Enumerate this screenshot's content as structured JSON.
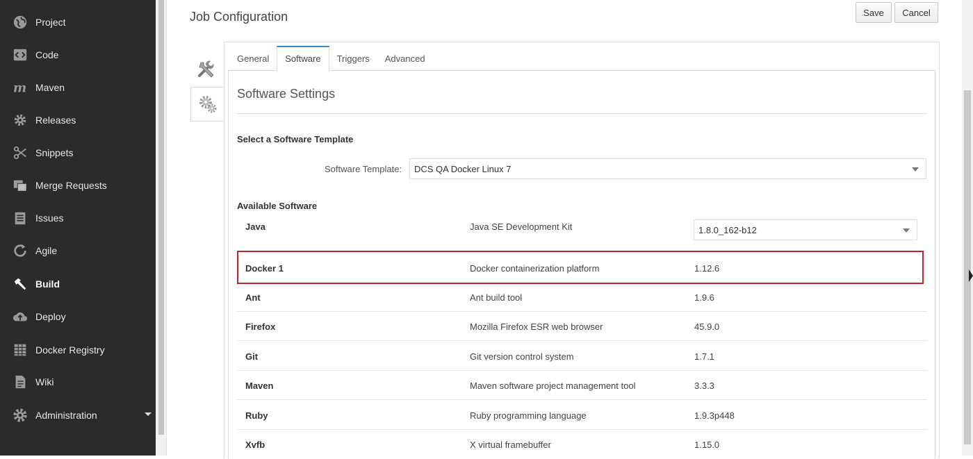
{
  "sidebar": {
    "items": [
      {
        "label": "Project",
        "icon": "globe-icon"
      },
      {
        "label": "Code",
        "icon": "code-icon"
      },
      {
        "label": "Maven",
        "icon": "maven-icon"
      },
      {
        "label": "Releases",
        "icon": "gear-icon"
      },
      {
        "label": "Snippets",
        "icon": "scissors-icon"
      },
      {
        "label": "Merge Requests",
        "icon": "merge-icon"
      },
      {
        "label": "Issues",
        "icon": "clipboard-icon"
      },
      {
        "label": "Agile",
        "icon": "refresh-icon"
      },
      {
        "label": "Build",
        "icon": "hammer-icon",
        "active": true
      },
      {
        "label": "Deploy",
        "icon": "cloud-upload-icon"
      },
      {
        "label": "Docker Registry",
        "icon": "registry-icon"
      },
      {
        "label": "Wiki",
        "icon": "document-icon"
      },
      {
        "label": "Administration",
        "icon": "cog-icon"
      }
    ]
  },
  "header": {
    "title": "Job Configuration",
    "save_label": "Save",
    "cancel_label": "Cancel"
  },
  "tools": [
    {
      "icon": "tools-icon",
      "selected": false
    },
    {
      "icon": "gears-icon",
      "selected": true
    }
  ],
  "tabs": [
    {
      "label": "General",
      "active": false
    },
    {
      "label": "Software",
      "active": true
    },
    {
      "label": "Triggers",
      "active": false
    },
    {
      "label": "Advanced",
      "active": false
    }
  ],
  "software_settings": {
    "title": "Software Settings",
    "template_heading": "Select a Software Template",
    "template_label": "Software Template:",
    "template_value": "DCS QA Docker Linux 7",
    "available_heading": "Available Software",
    "rows": [
      {
        "name": "Java",
        "description": "Java SE Development Kit",
        "version": "1.8.0_162-b12",
        "selectable": true
      },
      {
        "name": "Docker 1",
        "description": "Docker containerization platform",
        "version": "1.12.6",
        "highlighted": true
      },
      {
        "name": "Ant",
        "description": "Ant build tool",
        "version": "1.9.6"
      },
      {
        "name": "Firefox",
        "description": "Mozilla Firefox ESR web browser",
        "version": "45.9.0"
      },
      {
        "name": "Git",
        "description": "Git version control system",
        "version": "1.7.1"
      },
      {
        "name": "Maven",
        "description": "Maven software project management tool",
        "version": "3.3.3"
      },
      {
        "name": "Ruby",
        "description": "Ruby programming language",
        "version": "1.9.3p448"
      },
      {
        "name": "Xvfb",
        "description": "X virtual framebuffer",
        "version": "1.15.0"
      }
    ]
  },
  "colors": {
    "sidebar_bg": "#2b2b2b",
    "highlight_border": "#c8232c",
    "tab_accent": "#3a87c8"
  }
}
